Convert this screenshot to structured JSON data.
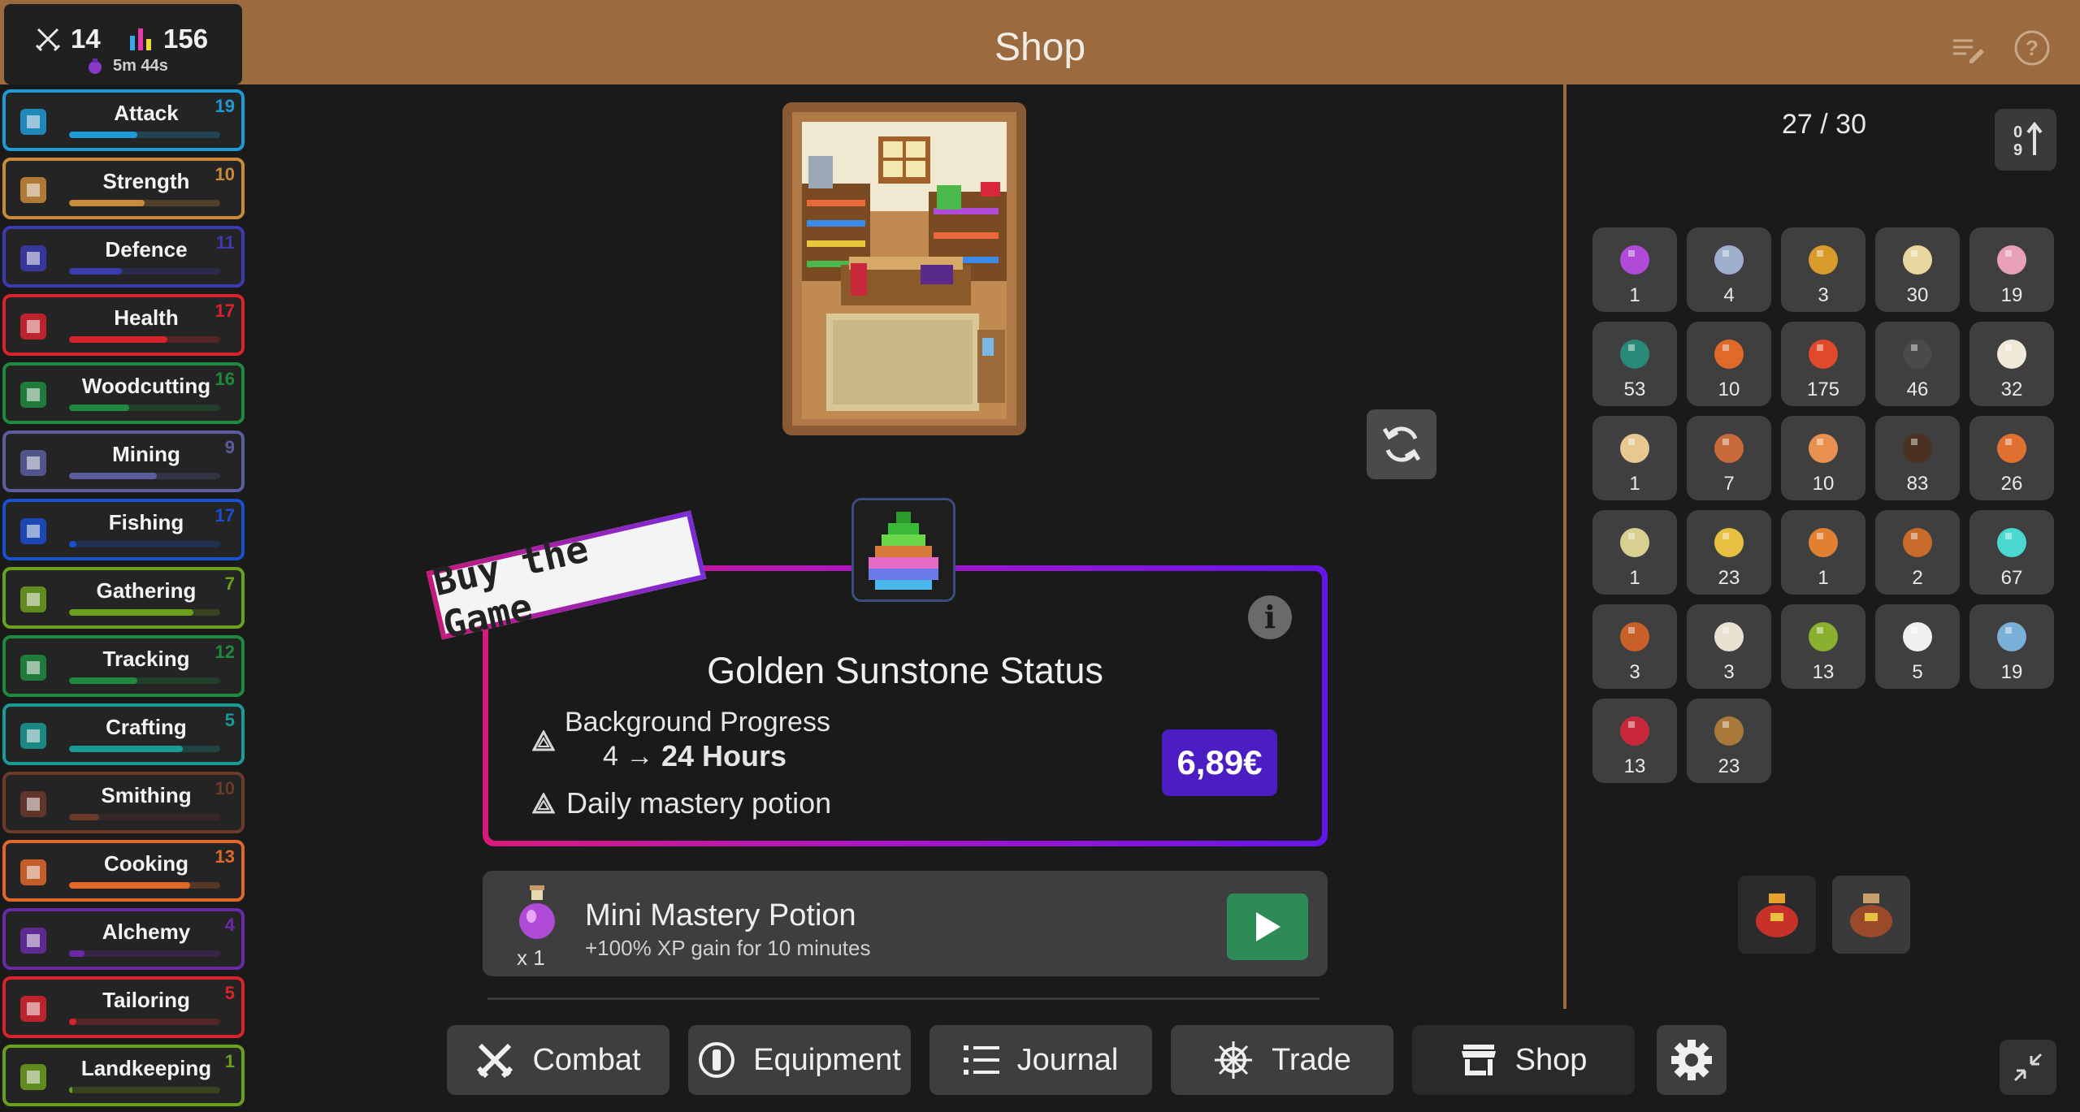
{
  "header": {
    "title": "Shop",
    "stat_combat": "14",
    "stat_total": "156",
    "stat_timer": "5m 44s"
  },
  "skills": [
    {
      "name": "Attack",
      "level": "19",
      "color": "#1e9ad6",
      "progress": 0.45
    },
    {
      "name": "Strength",
      "level": "10",
      "color": "#c98a3a",
      "progress": 0.5
    },
    {
      "name": "Defence",
      "level": "11",
      "color": "#3b3bb0",
      "progress": 0.35
    },
    {
      "name": "Health",
      "level": "17",
      "color": "#d8232f",
      "progress": 0.65
    },
    {
      "name": "Woodcutting",
      "level": "16",
      "color": "#1f8a3f",
      "progress": 0.4
    },
    {
      "name": "Mining",
      "level": "9",
      "color": "#5b5e9e",
      "progress": 0.58
    },
    {
      "name": "Fishing",
      "level": "17",
      "color": "#1a4fcf",
      "progress": 0.05
    },
    {
      "name": "Gathering",
      "level": "7",
      "color": "#6b9f1f",
      "progress": 0.82
    },
    {
      "name": "Tracking",
      "level": "12",
      "color": "#1f8a3f",
      "progress": 0.45
    },
    {
      "name": "Crafting",
      "level": "5",
      "color": "#1a9a94",
      "progress": 0.75
    },
    {
      "name": "Smithing",
      "level": "10",
      "color": "#6a3a2a",
      "progress": 0.2
    },
    {
      "name": "Cooking",
      "level": "13",
      "color": "#e0692a",
      "progress": 0.8
    },
    {
      "name": "Alchemy",
      "level": "4",
      "color": "#6a2aa8",
      "progress": 0.1
    },
    {
      "name": "Tailoring",
      "level": "5",
      "color": "#d8232f",
      "progress": 0.05
    },
    {
      "name": "Landkeeping",
      "level": "1",
      "color": "#6b9f1f",
      "progress": 0.02
    }
  ],
  "promo": {
    "ribbon": "Buy the Game",
    "title": "Golden Sunstone Status",
    "perk1_line1": "Background Progress",
    "perk1_from": "4 →",
    "perk1_to": "24 Hours",
    "perk2": "Daily mastery potion",
    "price": "6,89€",
    "info": "i"
  },
  "potion": {
    "name": "Mini Mastery Potion",
    "desc": "+100% XP gain for 10 minutes",
    "qty": "x 1"
  },
  "nav": [
    {
      "label": "Combat",
      "icon": "swords-icon"
    },
    {
      "label": "Equipment",
      "icon": "equipment-icon"
    },
    {
      "label": "Journal",
      "icon": "list-icon"
    },
    {
      "label": "Trade",
      "icon": "helm-icon"
    },
    {
      "label": "Shop",
      "icon": "store-icon"
    }
  ],
  "inventory": {
    "count": "27 / 30",
    "items": [
      {
        "qty": "1",
        "icon": "purple-potion-icon",
        "color": "#b04bd8"
      },
      {
        "qty": "4",
        "icon": "silver-gauntlet-icon",
        "color": "#9fb0cc"
      },
      {
        "qty": "3",
        "icon": "flower-icon",
        "color": "#d89a2a"
      },
      {
        "qty": "30",
        "icon": "torch-icon",
        "color": "#e8d8a0"
      },
      {
        "qty": "19",
        "icon": "pink-meat-icon",
        "color": "#e8a0b8"
      },
      {
        "qty": "53",
        "icon": "seaweed-icon",
        "color": "#2a8a7a"
      },
      {
        "qty": "10",
        "icon": "fishing-rod-icon",
        "color": "#e06a2a"
      },
      {
        "qty": "175",
        "icon": "red-flower-icon",
        "color": "#e04a2a"
      },
      {
        "qty": "46",
        "icon": "dark-stone-icon",
        "color": "#4a4a4a"
      },
      {
        "qty": "32",
        "icon": "cotton-icon",
        "color": "#f0e8d8"
      },
      {
        "qty": "1",
        "icon": "scroll-icon",
        "color": "#e8c890"
      },
      {
        "qty": "7",
        "icon": "leather-icon",
        "color": "#c86a3a"
      },
      {
        "qty": "10",
        "icon": "bandage-icon",
        "color": "#e89050"
      },
      {
        "qty": "83",
        "icon": "log-icon",
        "color": "#4a3020"
      },
      {
        "qty": "26",
        "icon": "axe-icon",
        "color": "#e07030"
      },
      {
        "qty": "1",
        "icon": "bone-icon",
        "color": "#d8d090"
      },
      {
        "qty": "23",
        "icon": "crystal-icon",
        "color": "#e8c040"
      },
      {
        "qty": "1",
        "icon": "bow-icon",
        "color": "#e08030"
      },
      {
        "qty": "2",
        "icon": "wand-icon",
        "color": "#c86a2a"
      },
      {
        "qty": "67",
        "icon": "eye-orb-icon",
        "color": "#4ad8d0"
      },
      {
        "qty": "3",
        "icon": "chest-armor-icon",
        "color": "#c8602a"
      },
      {
        "qty": "3",
        "icon": "pot-icon",
        "color": "#e8e0d0"
      },
      {
        "qty": "13",
        "icon": "herb-icon",
        "color": "#8ab030"
      },
      {
        "qty": "5",
        "icon": "eyeball-icon",
        "color": "#f0f0f0"
      },
      {
        "qty": "19",
        "icon": "fish-icon",
        "color": "#7ab0d8"
      },
      {
        "qty": "13",
        "icon": "berry-icon",
        "color": "#c8283a"
      },
      {
        "qty": "23",
        "icon": "boot-icon",
        "color": "#a8783a"
      }
    ]
  },
  "bags": [
    {
      "icon": "red-bag-icon",
      "color": "#c8302a"
    },
    {
      "icon": "brown-bag-icon",
      "color": "#9a4a2a"
    }
  ],
  "colors": {
    "header": "#9c6a3f",
    "price": "#4b1dc3",
    "play": "#2e8b57"
  }
}
